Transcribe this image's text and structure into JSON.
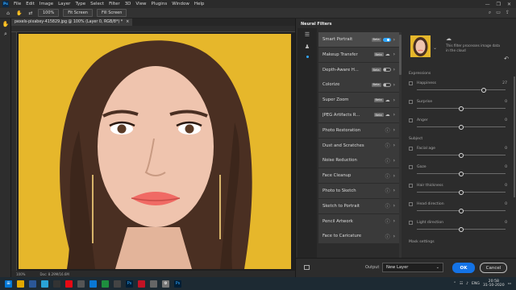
{
  "menubar": {
    "logo": "Ps",
    "items": [
      "File",
      "Edit",
      "Image",
      "Layer",
      "Type",
      "Select",
      "Filter",
      "3D",
      "View",
      "Plugins",
      "Window",
      "Help"
    ],
    "controls": [
      "—",
      "❐",
      "✕"
    ]
  },
  "options": {
    "zoom_value": "100%",
    "fit_screen": "Fit Screen",
    "fill_screen": "Fill Screen"
  },
  "document": {
    "tab_title": "pexels-pixabey-415829.jpg @ 100% (Layer 0, RGB/8*) *",
    "close": "×",
    "status_zoom": "100%",
    "status_doc": "Doc: 8.29M/16.6M"
  },
  "neural_filters": {
    "title": "Neural Filters",
    "filters": [
      {
        "name": "Smart Portrait",
        "beta": "Beta",
        "control": "toggle-on",
        "active": true
      },
      {
        "name": "Makeup Transfer",
        "beta": "Beta",
        "control": "cloud"
      },
      {
        "name": "Depth-Aware H...",
        "beta": "Beta",
        "control": "toggle-off"
      },
      {
        "name": "Colorize",
        "beta": "Beta",
        "control": "toggle-off"
      },
      {
        "name": "Super Zoom",
        "beta": "Beta",
        "control": "cloud"
      },
      {
        "name": "JPEG Artifacts R...",
        "beta": "Beta",
        "control": "cloud"
      },
      {
        "name": "Photo Restoration",
        "control": "info"
      },
      {
        "name": "Dust and Scratches",
        "control": "info"
      },
      {
        "name": "Noise Reduction",
        "control": "info"
      },
      {
        "name": "Face Cleanup",
        "control": "info"
      },
      {
        "name": "Photo to Sketch",
        "control": "info"
      },
      {
        "name": "Sketch to Portrait",
        "control": "info"
      },
      {
        "name": "Pencil Artwork",
        "control": "info"
      },
      {
        "name": "Face to Caricature",
        "control": "info"
      }
    ],
    "cloud_note": "This filter processes image data in the cloud",
    "expressions_label": "Expressions",
    "subject_label": "Subject",
    "mask_settings_label": "Mask settings",
    "sliders": [
      {
        "name": "Happiness",
        "value": "27",
        "checked": true,
        "level": 0.75
      },
      {
        "name": "Surprise",
        "value": "0",
        "checked": false,
        "level": 0.5
      },
      {
        "name": "Anger",
        "value": "0",
        "checked": false,
        "level": 0.5
      },
      {
        "name": "Facial age",
        "value": "0",
        "checked": false,
        "level": 0.5
      },
      {
        "name": "Gaze",
        "value": "0",
        "checked": false,
        "level": 0.5
      },
      {
        "name": "Hair thickness",
        "value": "0",
        "checked": false,
        "level": 0.5
      },
      {
        "name": "Head direction",
        "value": "0",
        "checked": false,
        "level": 0.5
      },
      {
        "name": "Light direction",
        "value": "0",
        "checked": false,
        "level": 0.5
      }
    ],
    "output_label": "Output",
    "output_value": "New Layer",
    "ok": "OK",
    "cancel": "Cancel"
  },
  "taskbar": {
    "lang": "ENG",
    "time": "20:58",
    "date": "31-10-2020"
  },
  "colors": {
    "accent": "#1473e6",
    "background_yellow": "#e6b72b"
  }
}
